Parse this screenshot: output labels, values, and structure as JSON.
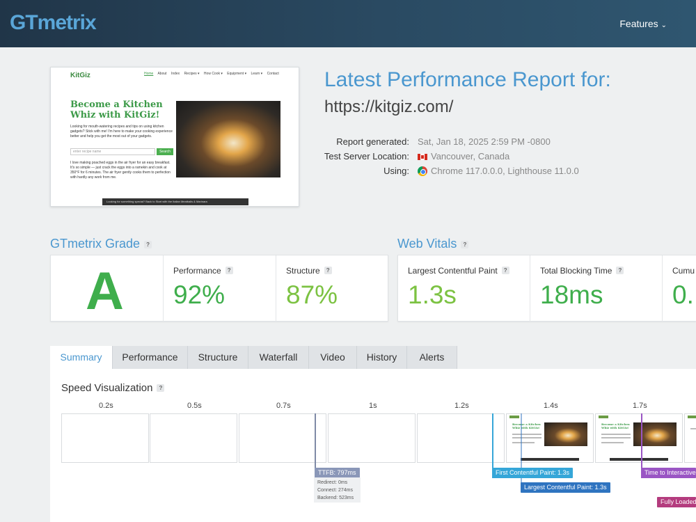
{
  "header": {
    "logo": "GTmetrix",
    "features_label": "Features"
  },
  "thumbnail": {
    "site_logo": "KitGiz",
    "nav": [
      "Home",
      "About",
      "Index",
      "Recipes ▾",
      "How Cook ▾",
      "Equipment ▾",
      "Learn ▾",
      "Contact"
    ],
    "headline": "Become a Kitchen Whiz with KitGiz!",
    "intro": "Looking for mouth-watering recipes and tips on using kitchen gadgets? Stick with me! I'm here to make your cooking experience better and help you get the most out of your gadgets.",
    "search_placeholder": "enter recipe name",
    "search_button": "Search",
    "teaser": "I love making poached eggs in the air fryer for an easy breakfast. It's so simple — just crack the eggs into a ramekin and cook at 350°F for 6 minutes. The air fryer gently cooks them to perfection with hardly any work from me.",
    "bottom_bar": "Looking for something special? Back to Start with the Italian Meatballs & Marinara"
  },
  "report": {
    "title": "Latest Performance Report for:",
    "url": "https://kitgiz.com/",
    "labels": {
      "generated": "Report generated:",
      "location": "Test Server Location:",
      "using": "Using:"
    },
    "generated": "Sat, Jan 18, 2025 2:59 PM -0800",
    "location": "Vancouver, Canada",
    "using": "Chrome 117.0.0.0, Lighthouse 11.0.0"
  },
  "grade": {
    "title": "GTmetrix Grade",
    "letter": "A",
    "performance_label": "Performance",
    "performance_value": "92%",
    "structure_label": "Structure",
    "structure_value": "87%"
  },
  "vitals": {
    "title": "Web Vitals",
    "lcp_label": "Largest Contentful Paint",
    "lcp_value": "1.3s",
    "tbt_label": "Total Blocking Time",
    "tbt_value": "18ms",
    "cls_label": "Cumu",
    "cls_value": "0."
  },
  "tabs": [
    "Summary",
    "Performance",
    "Structure",
    "Waterfall",
    "Video",
    "History",
    "Alerts"
  ],
  "speed_viz": {
    "title": "Speed Visualization",
    "ticks": [
      "0.2s",
      "0.5s",
      "0.7s",
      "1s",
      "1.2s",
      "1.4s",
      "1.7s"
    ],
    "markers": {
      "ttfb": "TTFB: 797ms",
      "ttfb_redirect": "Redirect: 0ms",
      "ttfb_connect": "Connect: 274ms",
      "ttfb_backend": "Backend: 523ms",
      "fcp": "First Contentful Paint: 1.3s",
      "lcp": "Largest Contentful Paint: 1.3s",
      "tti": "Time to Interactive",
      "fully_loaded": "Fully Loaded"
    }
  },
  "colors": {
    "brand_blue": "#4a97cf",
    "grade_green": "#3fae4c",
    "ttfb": "#8a97b8",
    "fcp": "#35a6d8",
    "lcp": "#2f74c0",
    "tti": "#9a55c4",
    "fully_loaded": "#b43c7e"
  }
}
